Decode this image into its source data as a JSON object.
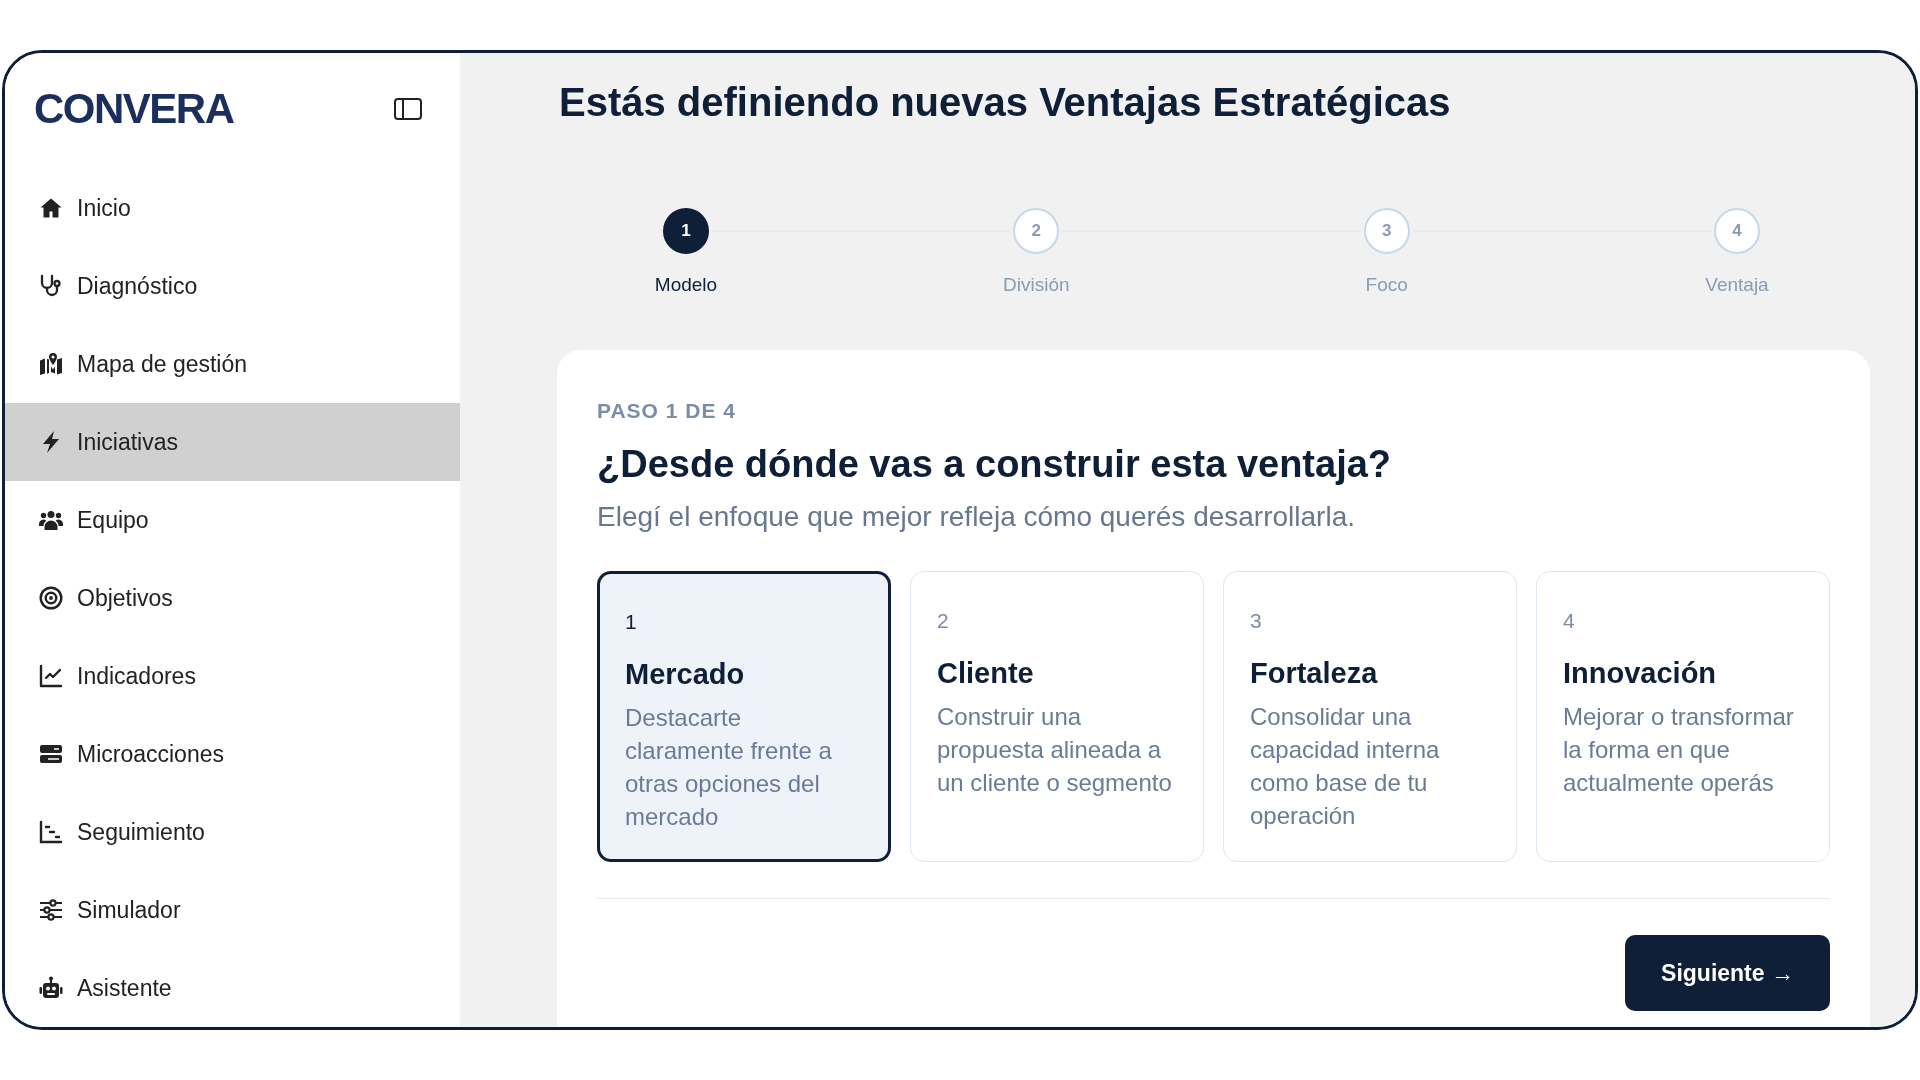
{
  "sidebar": {
    "logo": "CONVERA",
    "items": [
      {
        "label": "Inicio",
        "selected": false
      },
      {
        "label": "Diagnóstico",
        "selected": false
      },
      {
        "label": "Mapa de gestión",
        "selected": false
      },
      {
        "label": "Iniciativas",
        "selected": true
      },
      {
        "label": "Equipo",
        "selected": false
      },
      {
        "label": "Objetivos",
        "selected": false
      },
      {
        "label": "Indicadores",
        "selected": false
      },
      {
        "label": "Microacciones",
        "selected": false
      },
      {
        "label": "Seguimiento",
        "selected": false
      },
      {
        "label": "Simulador",
        "selected": false
      },
      {
        "label": "Asistente",
        "selected": false
      }
    ]
  },
  "header": {
    "title": "Estás definiendo nuevas Ventajas Estratégicas"
  },
  "stepper": {
    "steps": [
      {
        "number": "1",
        "label": "Modelo",
        "selected": true
      },
      {
        "number": "2",
        "label": "División",
        "selected": false
      },
      {
        "number": "3",
        "label": "Foco",
        "selected": false
      },
      {
        "number": "4",
        "label": "Ventaja",
        "selected": false
      }
    ]
  },
  "step_card": {
    "eyebrow": "PASO 1 DE 4",
    "question": "¿Desde dónde vas a construir esta ventaja?",
    "hint": "Elegí el enfoque que mejor refleja cómo querés desarrollarla.",
    "options": [
      {
        "number": "1",
        "title": "Mercado",
        "description": "Destacarte claramente frente a otras opciones del mercado",
        "selected": true
      },
      {
        "number": "2",
        "title": "Cliente",
        "description": "Construir una propuesta alineada a un cliente o segmento",
        "selected": false
      },
      {
        "number": "3",
        "title": "Fortaleza",
        "description": "Consolidar una capacidad interna como base de tu operación",
        "selected": false
      },
      {
        "number": "4",
        "title": "Innovación",
        "description": "Mejorar o transformar la forma en que actualmente operás",
        "selected": false
      }
    ],
    "next_button": "Siguiente →"
  }
}
